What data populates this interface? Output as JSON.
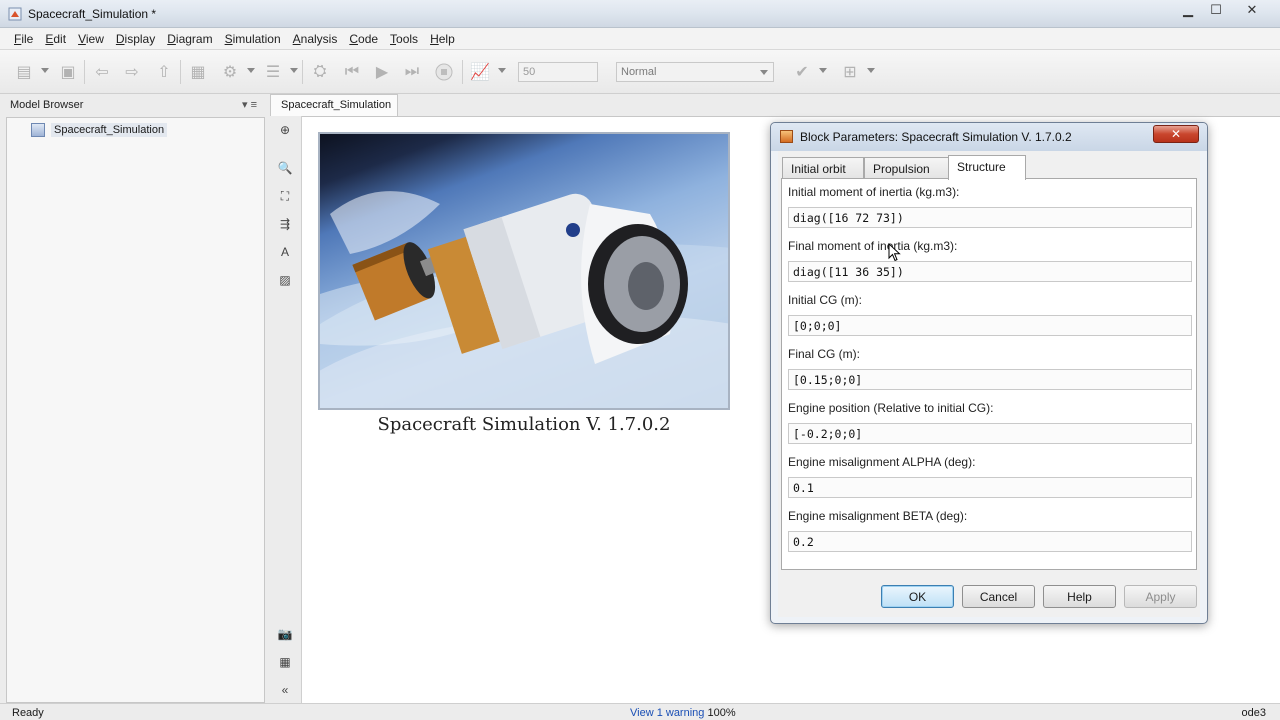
{
  "window": {
    "title": "Spacecraft_Simulation *"
  },
  "menu": [
    "File",
    "Edit",
    "View",
    "Display",
    "Diagram",
    "Simulation",
    "Analysis",
    "Code",
    "Tools",
    "Help"
  ],
  "toolbar": {
    "stop_time": "50",
    "sim_mode": "Normal"
  },
  "model_browser": {
    "header": "Model Browser",
    "root_item": "Spacecraft_Simulation"
  },
  "editor": {
    "tab_label": "Spacecraft_Simulation",
    "block_label": "Spacecraft Simulation V. 1.7.0.2"
  },
  "dialog": {
    "title": "Block Parameters: Spacecraft Simulation V. 1.7.0.2",
    "close_glyph": "✕",
    "tabs": [
      "Initial orbit",
      "Propulsion",
      "Structure"
    ],
    "active_tab": "Structure",
    "fields": [
      {
        "label": "Initial moment of inertia (kg.m3):",
        "value": "diag([16 72 73])"
      },
      {
        "label": "Final moment of inertia (kg.m3):",
        "value": "diag([11 36 35])"
      },
      {
        "label": "Initial CG (m):",
        "value": "[0;0;0]"
      },
      {
        "label": "Final CG (m):",
        "value": "[0.15;0;0]"
      },
      {
        "label": "Engine position (Relative to initial CG):",
        "value": "[-0.2;0;0]"
      },
      {
        "label": "Engine misalignment ALPHA (deg):",
        "value": "0.1"
      },
      {
        "label": "Engine misalignment BETA (deg):",
        "value": "0.2"
      }
    ],
    "buttons": {
      "ok": "OK",
      "cancel": "Cancel",
      "help": "Help",
      "apply": "Apply"
    }
  },
  "status": {
    "left": "Ready",
    "warning_link": "View 1 warning",
    "zoom": "100%",
    "solver": "ode3"
  }
}
